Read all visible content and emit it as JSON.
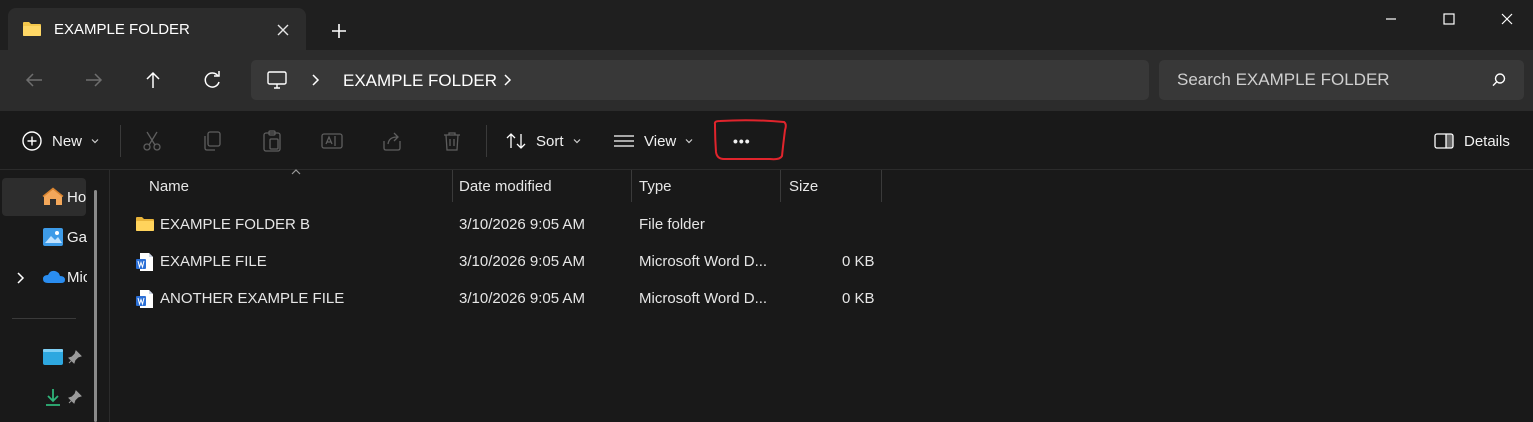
{
  "window": {
    "tab_title": "EXAMPLE FOLDER",
    "controls": [
      "minimize",
      "maximize",
      "close"
    ]
  },
  "address_bar": {
    "breadcrumb": "EXAMPLE FOLDER"
  },
  "search": {
    "placeholder": "Search EXAMPLE FOLDER"
  },
  "toolbar": {
    "new_label": "New",
    "sort_label": "Sort",
    "view_label": "View",
    "more_label": "•••",
    "details_label": "Details",
    "disabled_actions": [
      "cut",
      "copy",
      "paste",
      "rename",
      "share",
      "delete"
    ]
  },
  "nav_pane": {
    "items": [
      {
        "label": "Home",
        "icon": "home-icon"
      },
      {
        "label": "Gallery",
        "icon": "gallery-icon"
      },
      {
        "label": "Microsoft OneDrive",
        "icon": "onedrive-icon"
      }
    ],
    "pinned": [
      {
        "icon": "desktop-icon"
      },
      {
        "icon": "downloads-icon"
      }
    ]
  },
  "columns": [
    "Name",
    "Date modified",
    "Type",
    "Size"
  ],
  "files": [
    {
      "name": "EXAMPLE FOLDER B",
      "date": "3/10/2026 9:05 AM",
      "type": "File folder",
      "size": "",
      "icon": "folder-icon"
    },
    {
      "name": "EXAMPLE FILE",
      "date": "3/10/2026 9:05 AM",
      "type": "Microsoft Word D...",
      "size": "0 KB",
      "icon": "word-document-icon"
    },
    {
      "name": "ANOTHER EXAMPLE FILE",
      "date": "3/10/2026 9:05 AM",
      "type": "Microsoft Word D...",
      "size": "0 KB",
      "icon": "word-document-icon"
    }
  ],
  "colors": {
    "folder": "#f5c84c",
    "annotation": "#e0242c",
    "word_blue": "#2b6fd6"
  }
}
